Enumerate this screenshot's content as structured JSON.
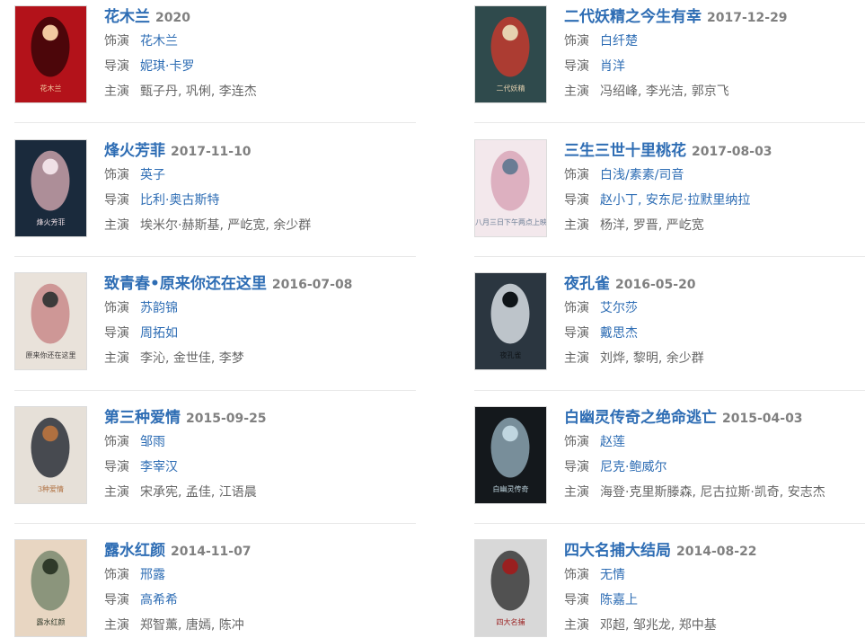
{
  "labels": {
    "role": "饰演",
    "director": "导演",
    "cast": "主演"
  },
  "colors": {
    "link": "#2e6db4",
    "date": "#808080",
    "text": "#666666",
    "separator": "#e8e8e8"
  },
  "movies": [
    {
      "title": "花木兰",
      "date": "2020",
      "role": "花木兰",
      "director": "妮琪·卡罗",
      "cast": "甄子丹, 巩俐, 李连杰",
      "poster_text": "花木兰"
    },
    {
      "title": "二代妖精之今生有幸",
      "date": "2017-12-29",
      "role": "白纤楚",
      "director": "肖洋",
      "cast": "冯绍峰, 李光洁, 郭京飞",
      "poster_text": "二代妖精"
    },
    {
      "title": "烽火芳菲",
      "date": "2017-11-10",
      "role": "英子",
      "director": "比利·奥古斯特",
      "cast": "埃米尔·赫斯基, 严屹宽, 余少群",
      "poster_text": "烽火芳菲"
    },
    {
      "title": "三生三世十里桃花",
      "date": "2017-08-03",
      "role": "白浅/素素/司音",
      "director": "赵小丁, 安东尼·拉默里纳拉",
      "cast": "杨洋, 罗晋, 严屹宽",
      "poster_text": "八月三日下午两点上映"
    },
    {
      "title": "致青春•原来你还在这里",
      "date": "2016-07-08",
      "role": "苏韵锦",
      "director": "周拓如",
      "cast": "李沁, 金世佳, 李梦",
      "poster_text": "原来你还在这里"
    },
    {
      "title": "夜孔雀",
      "date": "2016-05-20",
      "role": "艾尔莎",
      "director": "戴思杰",
      "cast": "刘烨, 黎明, 余少群",
      "poster_text": "夜孔雀"
    },
    {
      "title": "第三种爱情",
      "date": "2015-09-25",
      "role": "邹雨",
      "director": "李宰汉",
      "cast": "宋承宪, 孟佳, 江语晨",
      "poster_text": "3种爱情"
    },
    {
      "title": "白幽灵传奇之绝命逃亡",
      "date": "2015-04-03",
      "role": "赵莲",
      "director": "尼克·鲍威尔",
      "cast": "海登·克里斯滕森, 尼古拉斯·凯奇, 安志杰",
      "poster_text": "白幽灵传奇"
    },
    {
      "title": "露水红颜",
      "date": "2014-11-07",
      "role": "邢露",
      "director": "高希希",
      "cast": "郑智薰, 唐嫣, 陈冲",
      "poster_text": "露水红颜"
    },
    {
      "title": "四大名捕大结局",
      "date": "2014-08-22",
      "role": "无情",
      "director": "陈嘉上",
      "cast": "邓超, 邹兆龙, 郑中基",
      "poster_text": "四大名捕"
    }
  ],
  "poster_palettes": [
    [
      "#b3121a",
      "#3a0508",
      "#f2c9a0"
    ],
    [
      "#2f4a4c",
      "#c23a2e",
      "#e6d2b0"
    ],
    [
      "#1a2a3c",
      "#c8a0a8",
      "#f0e0e6"
    ],
    [
      "#f3e8ec",
      "#d8a6b8",
      "#6a7c94"
    ],
    [
      "#e9e2da",
      "#c98a8a",
      "#3d3a3a"
    ],
    [
      "#2b3640",
      "#d7dde3",
      "#0f1418"
    ],
    [
      "#e6e0d8",
      "#2a2f38",
      "#b07040"
    ],
    [
      "#14181c",
      "#8aa3b0",
      "#c0d6e0"
    ],
    [
      "#e8d6c2",
      "#7a8a70",
      "#2f3a2a"
    ],
    [
      "#d8d8d8",
      "#3a3a3a",
      "#9a2020"
    ]
  ]
}
